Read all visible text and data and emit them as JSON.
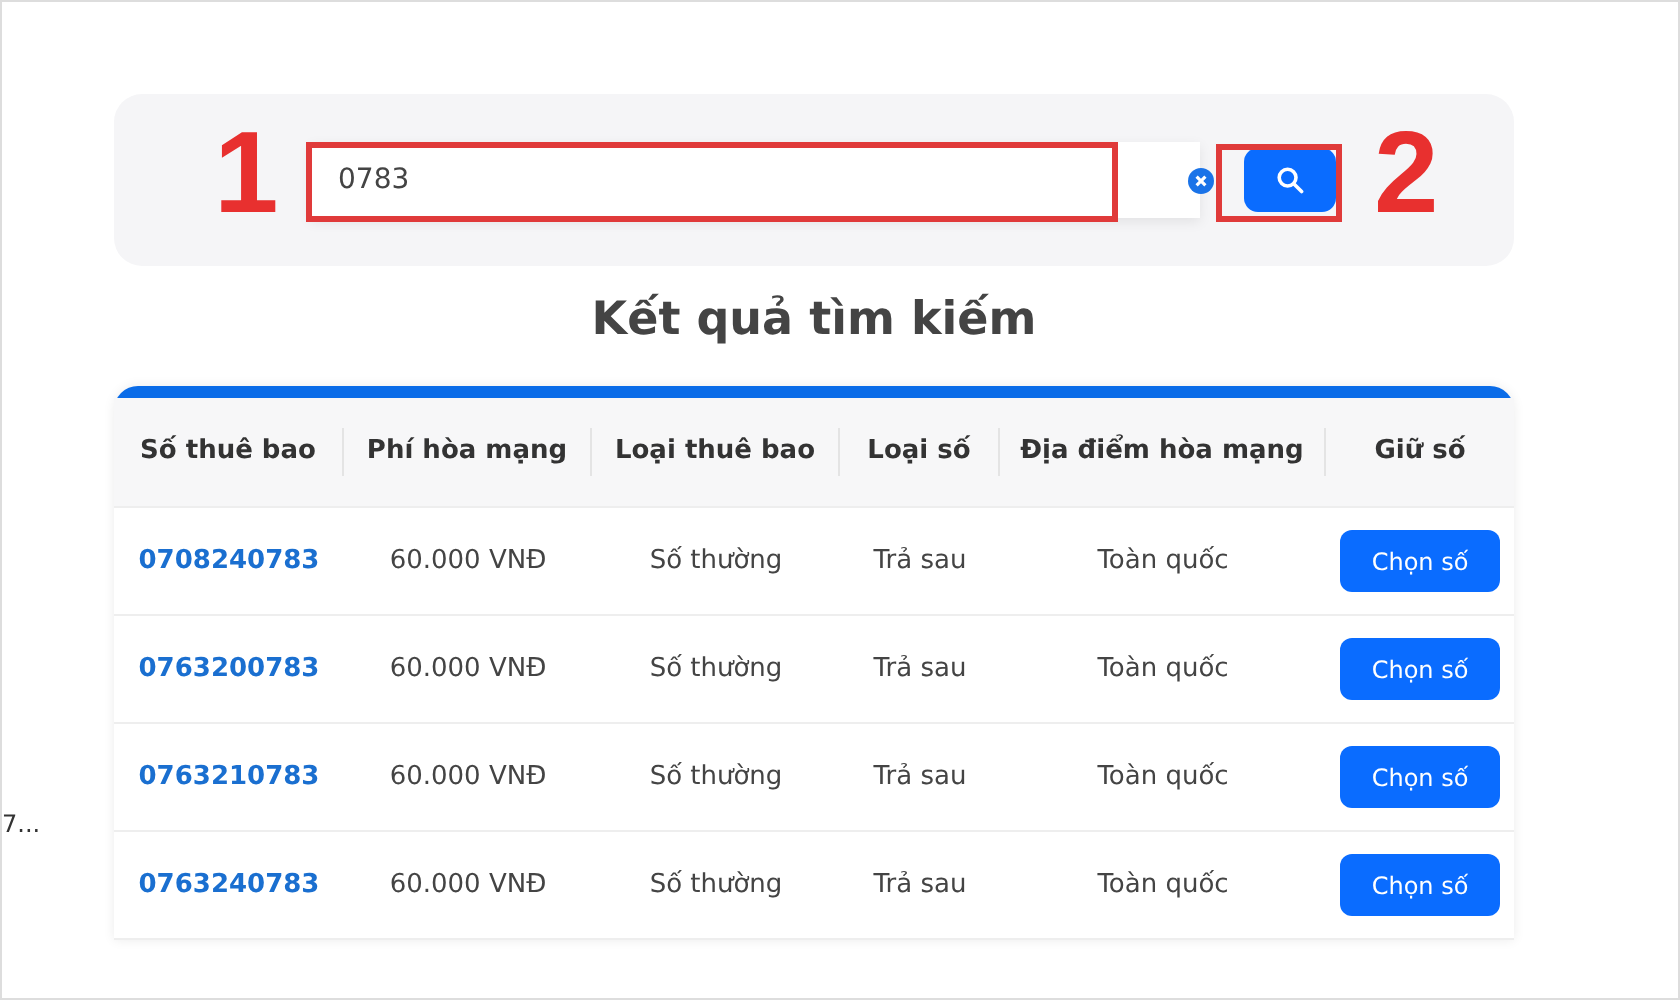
{
  "search": {
    "value": "0783",
    "field_marker": "1",
    "button_marker": "2"
  },
  "title": "Kết quả tìm kiếm",
  "side_text": "7...",
  "table": {
    "columns": [
      "Số thuê bao",
      "Phí hòa mạng",
      "Loại thuê bao",
      "Loại số",
      "Địa điểm hòa mạng",
      "Giữ số"
    ],
    "rows": [
      {
        "number": "0708240783",
        "fee": "60.000 VNĐ",
        "subscription": "Số thường",
        "type": "Trả sau",
        "location": "Toàn quốc",
        "action": "Chọn số"
      },
      {
        "number": "0763200783",
        "fee": "60.000 VNĐ",
        "subscription": "Số thường",
        "type": "Trả sau",
        "location": "Toàn quốc",
        "action": "Chọn số"
      },
      {
        "number": "0763210783",
        "fee": "60.000 VNĐ",
        "subscription": "Số thường",
        "type": "Trả sau",
        "location": "Toàn quốc",
        "action": "Chọn số"
      },
      {
        "number": "0763240783",
        "fee": "60.000 VNĐ",
        "subscription": "Số thường",
        "type": "Trả sau",
        "location": "Toàn quốc",
        "action": "Chọn số"
      }
    ]
  }
}
